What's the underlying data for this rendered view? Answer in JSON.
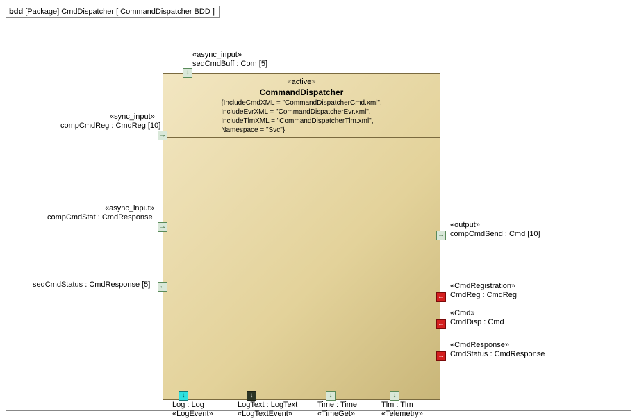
{
  "title": {
    "prefix": "bdd",
    "pkg": "[Package] CmdDispatcher [ CommandDispatcher BDD ]"
  },
  "block": {
    "stereo": "«active»",
    "name": "CommandDispatcher",
    "props": [
      "{IncludeCmdXML = \"CommandDispatcherCmd.xml\",",
      "IncludeEvrXML = \"CommandDispatcherEvr.xml\",",
      "IncludeTlmXML = \"CommandDispatcherTlm.xml\",",
      "Namespace = \"Svc\"}"
    ]
  },
  "ports": {
    "top": {
      "seqCmdBuff": {
        "stereo": "«async_input»",
        "label": "seqCmdBuff : Com [5]"
      }
    },
    "left": {
      "compCmdReg": {
        "stereo": "«sync_input»",
        "label": "compCmdReg : CmdReg [10]"
      },
      "compCmdStat": {
        "stereo": "«async_input»",
        "label": "compCmdStat : CmdResponse"
      },
      "seqCmdStatus": {
        "label": "seqCmdStatus : CmdResponse [5]"
      }
    },
    "right": {
      "compCmdSend": {
        "stereo": "«output»",
        "label": "compCmdSend : Cmd [10]"
      },
      "cmdReg": {
        "stereo": "«CmdRegistration»",
        "label": "CmdReg : CmdReg"
      },
      "cmdDisp": {
        "stereo": "«Cmd»",
        "label": "CmdDisp : Cmd"
      },
      "cmdStatus": {
        "stereo": "«CmdResponse»",
        "label": "CmdStatus : CmdResponse"
      }
    },
    "bottom": {
      "log": {
        "label": "Log : Log",
        "stereo": "«LogEvent»"
      },
      "logText": {
        "label": "LogText : LogText",
        "stereo": "«LogTextEvent»"
      },
      "time": {
        "label": "Time : Time",
        "stereo": "«TimeGet»"
      },
      "tlm": {
        "label": "Tlm : Tlm",
        "stereo": "«Telemetry»"
      }
    }
  }
}
